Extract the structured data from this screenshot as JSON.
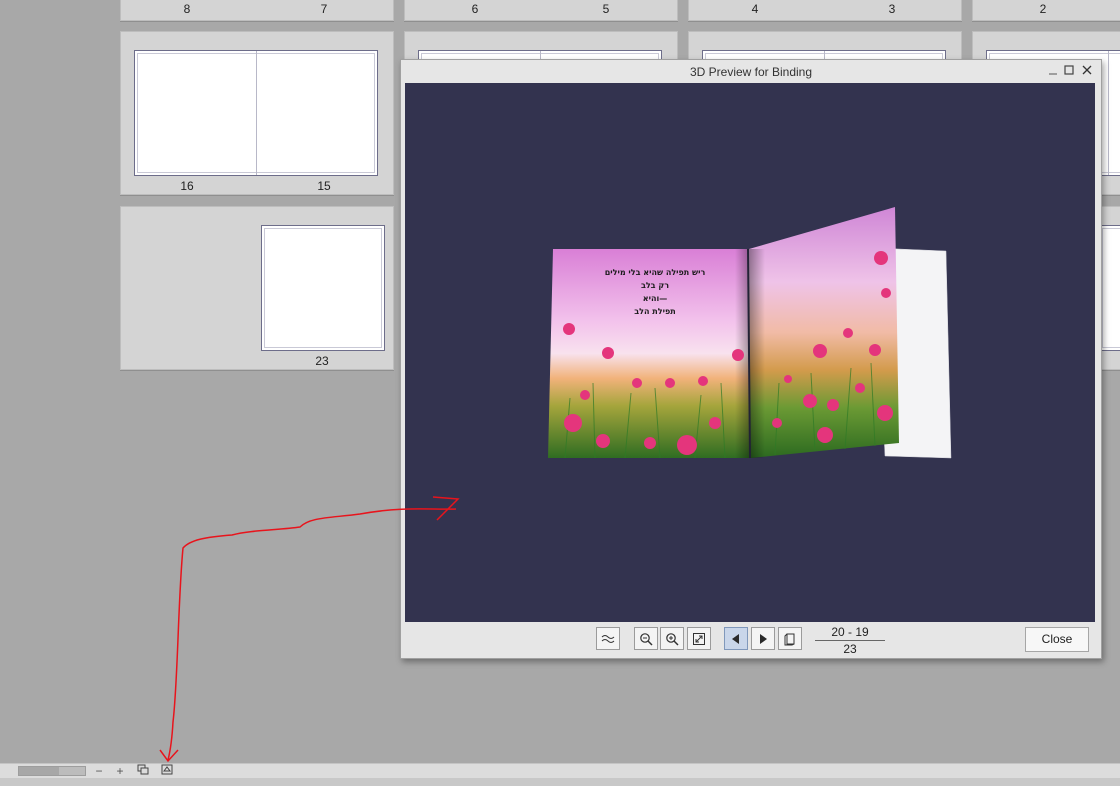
{
  "thumbnails": {
    "top_row_numbers": [
      "8",
      "7",
      "6",
      "5",
      "4",
      "3",
      "2"
    ],
    "spread_16_15": {
      "left": "16",
      "right": "15"
    },
    "single_23": "23"
  },
  "dialog": {
    "title": "3D Preview for Binding",
    "minimize_icon": "minimize-icon",
    "maximize_icon": "maximize-icon",
    "close_icon": "close-x-icon",
    "book": {
      "left_page_lines": [
        "ריש תפילה שהיא בלי מילים",
        "רק בלב",
        "והיא—",
        "תפילת הלב"
      ]
    },
    "controls": {
      "wave_icon": "page-curl-icon",
      "zoom_out_icon": "zoom-out-icon",
      "zoom_in_icon": "zoom-in-icon",
      "fit_icon": "fit-to-window-icon",
      "prev_icon": "triangle-left-icon",
      "next_icon": "triangle-right-icon",
      "cover_icon": "book-cover-icon"
    },
    "pager": {
      "current": "20 - 19",
      "total": "23"
    },
    "close_label": "Close"
  },
  "bottom_bar": {
    "zoom_minus": "−",
    "zoom_plus": "+",
    "slider_level": 0.6,
    "icons": [
      "page-layout-icon",
      "3d-preview-icon"
    ]
  },
  "colors": {
    "viewport_bg": "#33334f",
    "annotation": "#e8141c"
  }
}
